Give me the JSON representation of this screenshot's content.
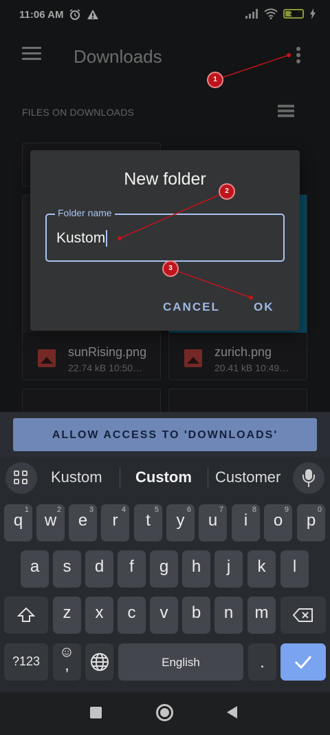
{
  "status": {
    "time": "11:06 AM",
    "battery": "36"
  },
  "app_bar": {
    "title": "Downloads"
  },
  "section": {
    "label": "FILES ON DOWNLOADS"
  },
  "files": [
    {
      "name": "sunRising.png",
      "meta": "22.74 kB 10:50…",
      "thumb_color": "#2b2c2f"
    },
    {
      "name": "zurich.png",
      "meta": "20.41 kB 10:49…",
      "thumb_color": "#0f6f92"
    }
  ],
  "dialog": {
    "title": "New folder",
    "field_label": "Folder name",
    "field_value": "Kustom",
    "cancel_label": "CANCEL",
    "ok_label": "OK"
  },
  "annotations": [
    "1",
    "2",
    "3"
  ],
  "access_button": "ALLOW ACCESS TO 'DOWNLOADS'",
  "keyboard": {
    "suggestions": [
      "Kustom",
      "Custom",
      "Customer"
    ],
    "row1": [
      {
        "ch": "q",
        "hint": "1"
      },
      {
        "ch": "w",
        "hint": "2"
      },
      {
        "ch": "e",
        "hint": "3"
      },
      {
        "ch": "r",
        "hint": "4"
      },
      {
        "ch": "t",
        "hint": "5"
      },
      {
        "ch": "y",
        "hint": "6"
      },
      {
        "ch": "u",
        "hint": "7"
      },
      {
        "ch": "i",
        "hint": "8"
      },
      {
        "ch": "o",
        "hint": "9"
      },
      {
        "ch": "p",
        "hint": "0"
      }
    ],
    "row2": [
      "a",
      "s",
      "d",
      "f",
      "g",
      "h",
      "j",
      "k",
      "l"
    ],
    "row3": [
      "z",
      "x",
      "c",
      "v",
      "b",
      "n",
      "m"
    ],
    "symbols_label": "?123",
    "space_label": "English",
    "period_label": ".",
    "comma_label": ","
  },
  "colors": {
    "accent": "#a8c4f2",
    "annotation": "#c0141c",
    "access_button": "#6f87b6",
    "enter_key": "#7aa3f0"
  }
}
